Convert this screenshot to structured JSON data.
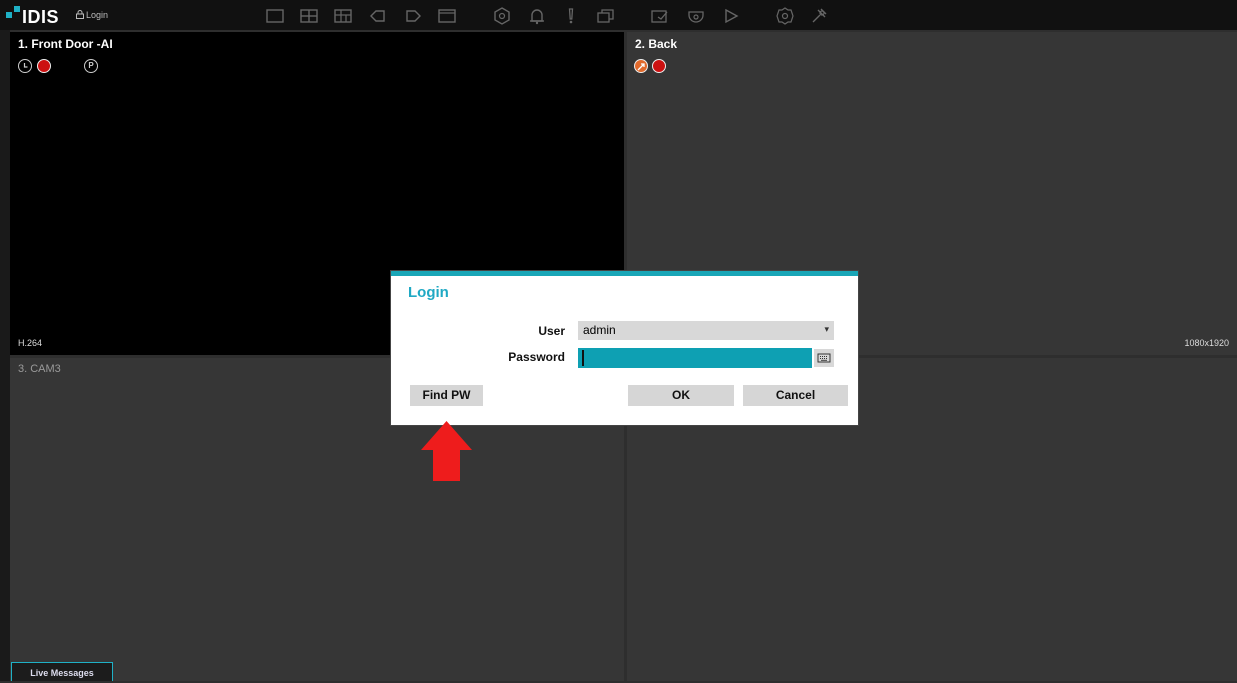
{
  "app": {
    "logo_text": "IDIS",
    "login_link": "Login",
    "toolbar_icons": [
      "layout-1x1-icon",
      "layout-2x2-icon",
      "layout-3x3-icon",
      "prev-group-icon",
      "next-group-icon",
      "sequence-icon",
      "camera-group-icon",
      "alarm-bell-icon",
      "alert-icon",
      "multi-window-icon",
      "record-check-icon",
      "ptz-dome-icon",
      "playback-icon",
      "settings-gear-icon",
      "tools-icon"
    ]
  },
  "cameras": [
    {
      "title": "1. Front Door -AI",
      "codec": "H.264",
      "resolution": ""
    },
    {
      "title": "2. Back",
      "codec": "",
      "resolution": "1080x1920"
    },
    {
      "title": "3. CAM3",
      "codec": "",
      "resolution": ""
    },
    {
      "title": "",
      "codec": "",
      "resolution": ""
    }
  ],
  "live_messages_tab": "Live Messages",
  "dialog": {
    "title": "Login",
    "user_label": "User",
    "user_value": "admin",
    "password_label": "Password",
    "password_value": "",
    "find_pw_label": "Find PW",
    "ok_label": "OK",
    "cancel_label": "Cancel"
  },
  "colors": {
    "accent": "#1fa9c4",
    "password_field": "#0ea0b3",
    "annotation_arrow": "#ee1c1c"
  }
}
